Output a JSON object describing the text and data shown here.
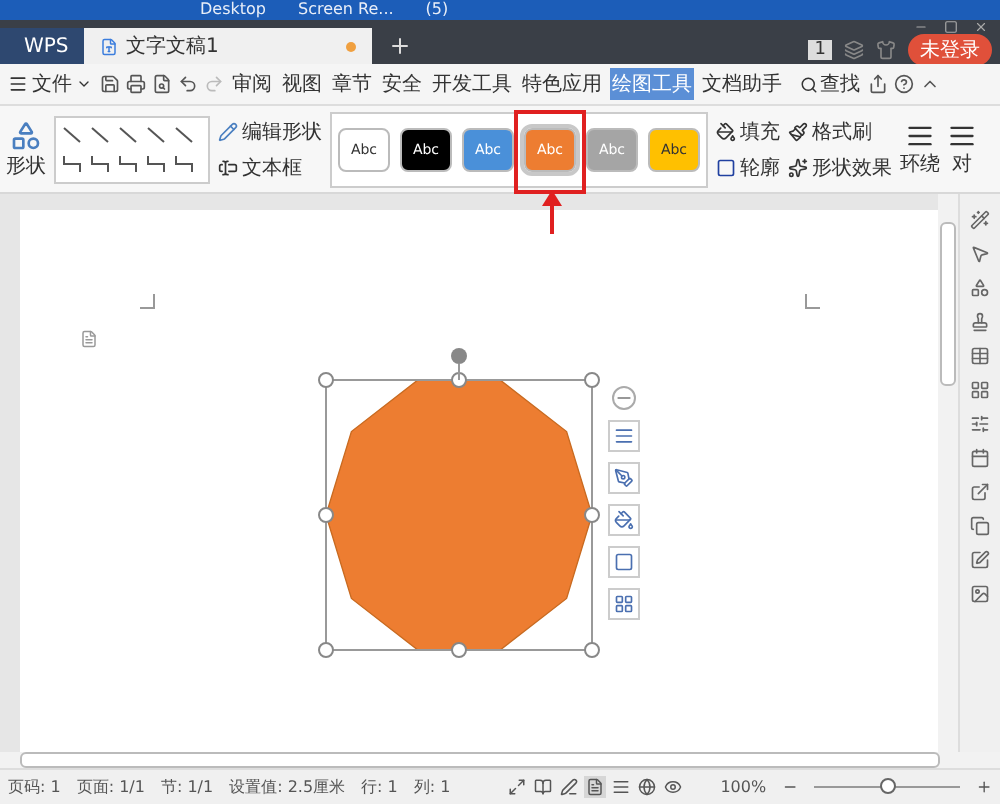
{
  "taskbar": {
    "items": [
      "Desktop",
      "Screen Re...",
      "(5)"
    ]
  },
  "tabs": [
    {
      "label": "WPS",
      "kind": "app",
      "selected": false
    },
    {
      "label": "文字文稿1",
      "kind": "document",
      "selected": true,
      "modified": true
    }
  ],
  "account": {
    "page_count": "1",
    "login": "未登录"
  },
  "menu": {
    "file": "文件",
    "items": [
      {
        "label": "审阅",
        "selected": false
      },
      {
        "label": "视图",
        "selected": false
      },
      {
        "label": "章节",
        "selected": false
      },
      {
        "label": "安全",
        "selected": false
      },
      {
        "label": "开发工具",
        "selected": false
      },
      {
        "label": "特色应用",
        "selected": false
      },
      {
        "label": "绘图工具",
        "selected": true
      },
      {
        "label": "文档助手",
        "selected": false
      }
    ],
    "search": "查找"
  },
  "ribbon": {
    "shape": "形状",
    "edit_shape": "编辑形状",
    "text_box": "文本框",
    "styles": [
      {
        "label": "Abc",
        "color": "#ffffff",
        "selected": false,
        "highlighted": false
      },
      {
        "label": "Abc",
        "color": "#000000",
        "selected": false,
        "highlighted": false
      },
      {
        "label": "Abc",
        "color": "#4a90d9",
        "selected": false,
        "highlighted": false
      },
      {
        "label": "Abc",
        "color": "#ed7d31",
        "selected": true,
        "highlighted": true
      },
      {
        "label": "Abc",
        "color": "#a5a5a5",
        "selected": false,
        "highlighted": false
      },
      {
        "label": "Abc",
        "color": "#ffc000",
        "selected": false,
        "highlighted": false
      }
    ],
    "fill": "填充",
    "format_painter": "格式刷",
    "outline": "轮廓",
    "effects": "形状效果",
    "wrap": "环绕",
    "align": "对"
  },
  "shape": {
    "kind": "decagon",
    "color": "#ed7d31",
    "selected": true
  },
  "status": {
    "items": [
      "页码: 1",
      "页面: 1/1",
      "节: 1/1",
      "设置值: 2.5厘米",
      "行: 1",
      "列: 1"
    ],
    "views": [
      {
        "kind": "fullscreen",
        "selected": false
      },
      {
        "kind": "read",
        "selected": false
      },
      {
        "kind": "write",
        "selected": false
      },
      {
        "kind": "page",
        "selected": true
      },
      {
        "kind": "outline",
        "selected": false
      },
      {
        "kind": "web",
        "selected": false
      },
      {
        "kind": "eye",
        "selected": false
      }
    ],
    "zoom": "100%",
    "zoom_level": {
      "level": 0.5
    }
  }
}
